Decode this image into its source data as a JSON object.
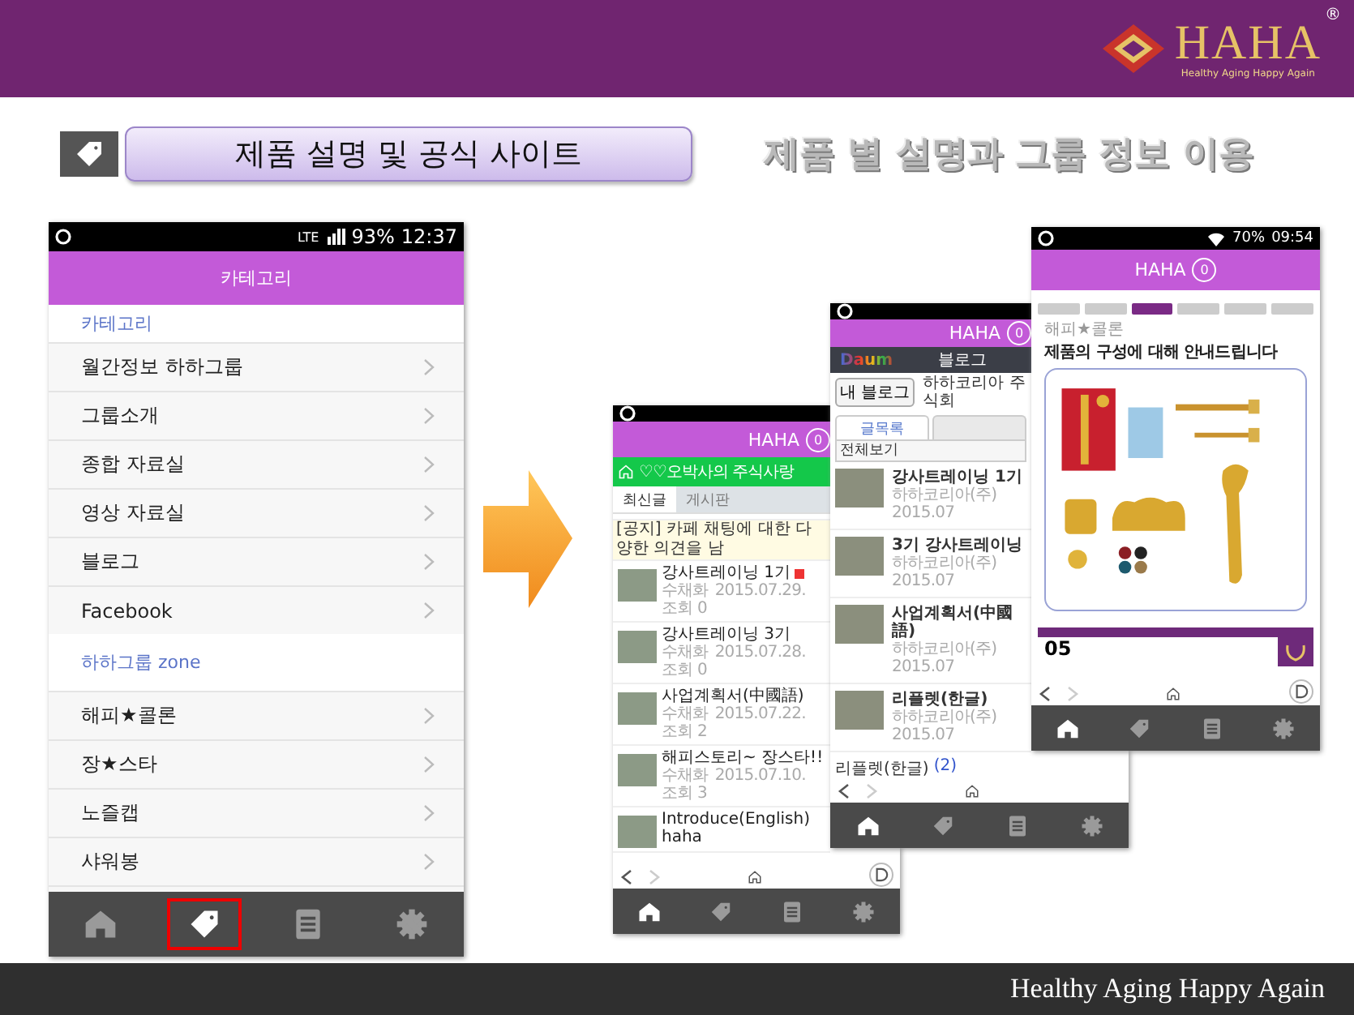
{
  "header": {
    "logo": {
      "wordmark": "HAHA",
      "tagline": "Healthy Aging Happy Again",
      "registered": "®"
    }
  },
  "title": {
    "label": "제품 설명 및 공식 사이트",
    "caption": "제품 별 설명과 그룹 정보 이용"
  },
  "phones": [
    {
      "kind": "category",
      "status": {
        "network": "LTE",
        "battery": "93%",
        "time": "12:37"
      },
      "app_bar": {
        "title": "카테고리"
      },
      "sections": [
        {
          "label": "카테고리",
          "items": [
            "월간정보 하하그룹",
            "그룹소개",
            "종합 자료실",
            "영상 자료실",
            "블로그",
            "Facebook"
          ]
        },
        {
          "label": "하하그룹 zone",
          "items": [
            "해피★콜론",
            "장★스타",
            "노즐캡",
            "샤워봉"
          ]
        }
      ],
      "bottom_nav": [
        {
          "kind": "home",
          "selected": false,
          "highlighted": false
        },
        {
          "kind": "tag",
          "selected": true,
          "highlighted": true
        },
        {
          "kind": "document",
          "selected": false,
          "highlighted": false
        },
        {
          "kind": "settings",
          "selected": false,
          "highlighted": false
        }
      ]
    },
    {
      "kind": "cafe",
      "app_bar": {
        "title": "HAHA",
        "badge": "0"
      },
      "cafe_bar": {
        "title": "♡♡오박사의 주식사랑"
      },
      "tabs": [
        {
          "label": "최신글",
          "selected": true
        },
        {
          "label": "게시판",
          "selected": false
        }
      ],
      "notice": "[공지] 카페 채팅에 대한 다양한 의견을 남",
      "posts": [
        {
          "title": "강사트레이닝 1기",
          "new": true,
          "author": "수채화",
          "date": "2015.07.29.",
          "views": "조회 0"
        },
        {
          "title": "강사트레이닝 3기",
          "new": false,
          "author": "수채화",
          "date": "2015.07.28.",
          "views": "조회 0"
        },
        {
          "title": "사업계획서(中國語)",
          "new": false,
          "author": "수채화",
          "date": "2015.07.22.",
          "views": "조회 2"
        },
        {
          "title": "해피스토리~ 장스타!!",
          "new": false,
          "author": "수채화",
          "date": "2015.07.10.",
          "views": "조회 3"
        },
        {
          "title": "Introduce(English) haha",
          "new": false
        }
      ],
      "nav": {
        "forward_enabled": false,
        "floating_button": true
      },
      "bottom_nav": [
        {
          "kind": "home",
          "selected": true
        },
        {
          "kind": "tag",
          "selected": false
        },
        {
          "kind": "document",
          "selected": false
        },
        {
          "kind": "settings",
          "selected": false
        }
      ]
    },
    {
      "kind": "blog",
      "app_bar": {
        "title": "HAHA",
        "badge": "0"
      },
      "blog_bar": {
        "logo": "Daum",
        "title": "블로그"
      },
      "my_blog_button": "내 블로그",
      "blog_name": "하하코리아 주식회",
      "tabs": [
        {
          "label": "글목록",
          "selected": true
        },
        {
          "selected": false
        }
      ],
      "filter": "전체보기",
      "posts": [
        {
          "title": "강사트레이닝 1기",
          "author": "하하코리아(주)",
          "date": "2015.07"
        },
        {
          "title": "3기 강사트레이닝",
          "author": "하하코리아(주)",
          "date": "2015.07"
        },
        {
          "title": "사업계획서(中國語)",
          "author": "하하코리아(주)",
          "date": "2015.07"
        },
        {
          "title": "리플렛(한글)",
          "author": "하하코리아(주)",
          "date": "2015.07"
        }
      ],
      "category_footer": {
        "label": "리플렛(한글)",
        "count": "(2)"
      },
      "nav": {
        "forward_enabled": false
      },
      "bottom_nav": [
        {
          "kind": "home",
          "selected": true
        },
        {
          "kind": "tag",
          "selected": false
        },
        {
          "kind": "document",
          "selected": false
        },
        {
          "kind": "settings",
          "selected": false
        }
      ]
    },
    {
      "kind": "product",
      "status": {
        "battery": "70%",
        "time": "09:54"
      },
      "app_bar": {
        "title": "HAHA",
        "badge": "0"
      },
      "product_tabs": [
        {
          "selected": false
        },
        {
          "selected": false
        },
        {
          "selected": true
        },
        {
          "selected": false
        },
        {
          "selected": false
        },
        {
          "selected": false
        }
      ],
      "breadcrumb": "해피★콜론",
      "heading": "제품의 구성에 대해 안내드립니다",
      "section_number": "05",
      "nav": {
        "forward_enabled": false,
        "floating_button": true
      },
      "bottom_nav": [
        {
          "kind": "home",
          "selected": true
        },
        {
          "kind": "tag",
          "selected": false
        },
        {
          "kind": "document",
          "selected": false
        },
        {
          "kind": "settings",
          "selected": false
        }
      ]
    }
  ],
  "footer": {
    "text": "Healthy Aging Happy Again"
  }
}
